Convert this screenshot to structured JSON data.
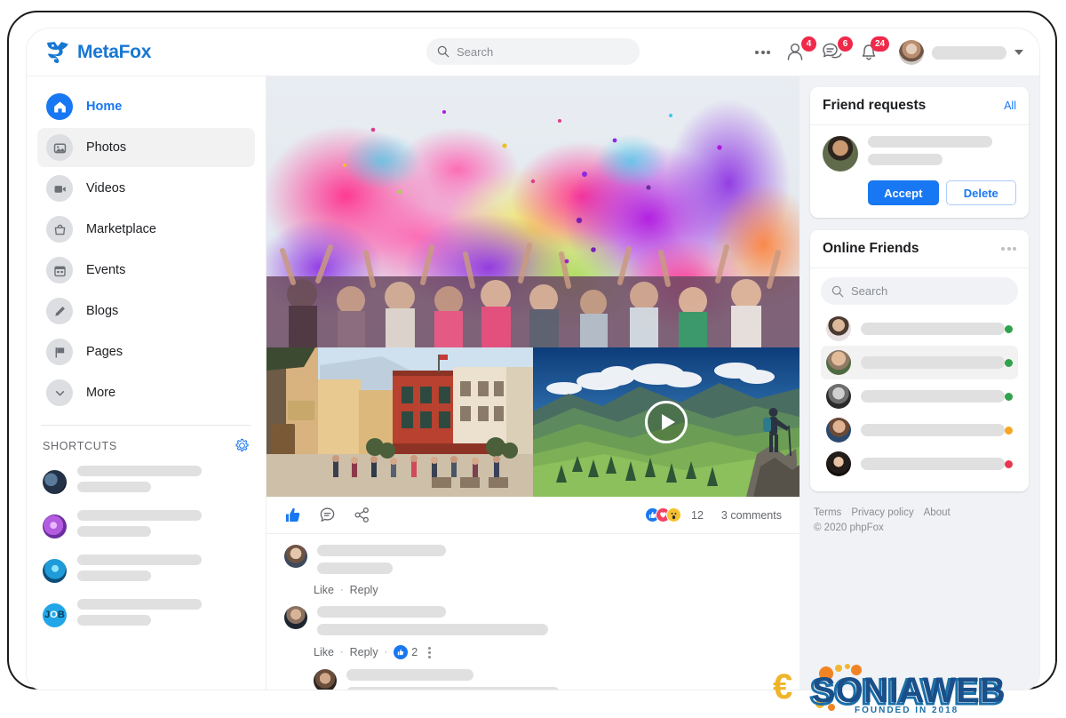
{
  "brand": {
    "name": "MetaFox",
    "icon": "fox-logo-icon",
    "color": "#1877d2"
  },
  "header": {
    "search": {
      "placeholder": "Search",
      "value": "",
      "icon": "search-icon"
    },
    "more_icon": "more-horizontal-icon",
    "icons": [
      {
        "name": "friend-requests-icon",
        "badge": "4"
      },
      {
        "name": "messages-icon",
        "badge": "6"
      },
      {
        "name": "notifications-icon",
        "badge": "24"
      }
    ],
    "user": {
      "avatar": "user-avatar",
      "name": "",
      "chevron": "chevron-down-icon"
    }
  },
  "sidebar": {
    "items": [
      {
        "label": "Home",
        "icon": "home-icon",
        "active": true,
        "hovered": false
      },
      {
        "label": "Photos",
        "icon": "photo-icon",
        "active": false,
        "hovered": true
      },
      {
        "label": "Videos",
        "icon": "video-icon",
        "active": false,
        "hovered": false
      },
      {
        "label": "Marketplace",
        "icon": "marketplace-bag-icon",
        "active": false,
        "hovered": false
      },
      {
        "label": "Events",
        "icon": "calendar-icon",
        "active": false,
        "hovered": false
      },
      {
        "label": "Blogs",
        "icon": "pencil-icon",
        "active": false,
        "hovered": false
      },
      {
        "label": "Pages",
        "icon": "flag-icon",
        "active": false,
        "hovered": false
      },
      {
        "label": "More",
        "icon": "chevron-down-icon",
        "active": false,
        "hovered": false
      }
    ],
    "shortcuts": {
      "title": "SHORTCUTS",
      "settings_icon": "gear-icon",
      "items": [
        {
          "avatar": "shortcut-avatar-1",
          "label": "",
          "sublabel": ""
        },
        {
          "avatar": "shortcut-avatar-2",
          "label": "",
          "sublabel": ""
        },
        {
          "avatar": "shortcut-avatar-3",
          "label": "",
          "sublabel": ""
        },
        {
          "avatar": "shortcut-avatar-4",
          "label": "",
          "sublabel": ""
        }
      ]
    }
  },
  "feed": {
    "post": {
      "hero_image": "holi-color-festival-crowd",
      "images": [
        {
          "name": "italian-village-street",
          "is_video": false
        },
        {
          "name": "mountain-hiker-video",
          "is_video": true,
          "play_icon": "play-icon"
        }
      ],
      "actions": [
        {
          "name": "like-button",
          "icon": "thumbs-up-icon"
        },
        {
          "name": "comment-button",
          "icon": "comment-bubble-icon"
        },
        {
          "name": "share-button",
          "icon": "share-icon"
        }
      ],
      "reactions": {
        "icons": [
          "like-reaction",
          "love-reaction",
          "wow-reaction"
        ],
        "count": "12"
      },
      "comments_label": "3 comments"
    },
    "comments": [
      {
        "avatar": "comment-avatar-1",
        "text": "",
        "like_label": "Like",
        "reply_label": "Reply",
        "likes": null,
        "nested": false
      },
      {
        "avatar": "comment-avatar-2",
        "text": "",
        "like_label": "Like",
        "reply_label": "Reply",
        "likes": "2",
        "nested": false
      },
      {
        "avatar": "comment-avatar-3",
        "text": "",
        "like_label": "",
        "reply_label": "",
        "likes": null,
        "nested": true
      }
    ]
  },
  "right": {
    "friend_requests": {
      "title": "Friend requests",
      "all_label": "All",
      "request": {
        "avatar": "friend-request-avatar",
        "name": "",
        "meta": ""
      },
      "accept_label": "Accept",
      "delete_label": "Delete"
    },
    "online_friends": {
      "title": "Online Friends",
      "menu_icon": "more-horizontal-icon",
      "search": {
        "placeholder": "Search",
        "value": "",
        "icon": "search-icon"
      },
      "friends": [
        {
          "avatar": "friend-avatar-1",
          "name": "",
          "status": "online",
          "status_color": "#31a24c",
          "hovered": false
        },
        {
          "avatar": "friend-avatar-2",
          "name": "",
          "status": "online",
          "status_color": "#31a24c",
          "hovered": true
        },
        {
          "avatar": "friend-avatar-3",
          "name": "",
          "status": "online",
          "status_color": "#31a24c",
          "hovered": false
        },
        {
          "avatar": "friend-avatar-4",
          "name": "",
          "status": "away",
          "status_color": "#f5a623",
          "hovered": false
        },
        {
          "avatar": "friend-avatar-5",
          "name": "",
          "status": "busy",
          "status_color": "#e8384f",
          "hovered": false
        }
      ]
    },
    "footer": {
      "links": [
        "Terms",
        "Privacy policy",
        "About"
      ],
      "copyright": "© 2020 phpFox"
    }
  },
  "watermark": {
    "brand": "SONIAWEB",
    "tagline": "FOUNDED IN 2018",
    "symbol": "€"
  },
  "colors": {
    "accent": "#1877f2",
    "badge": "#f02849",
    "online": "#31a24c",
    "away": "#f5a623",
    "busy": "#e8384f",
    "page_bg": "#f0f2f5"
  }
}
